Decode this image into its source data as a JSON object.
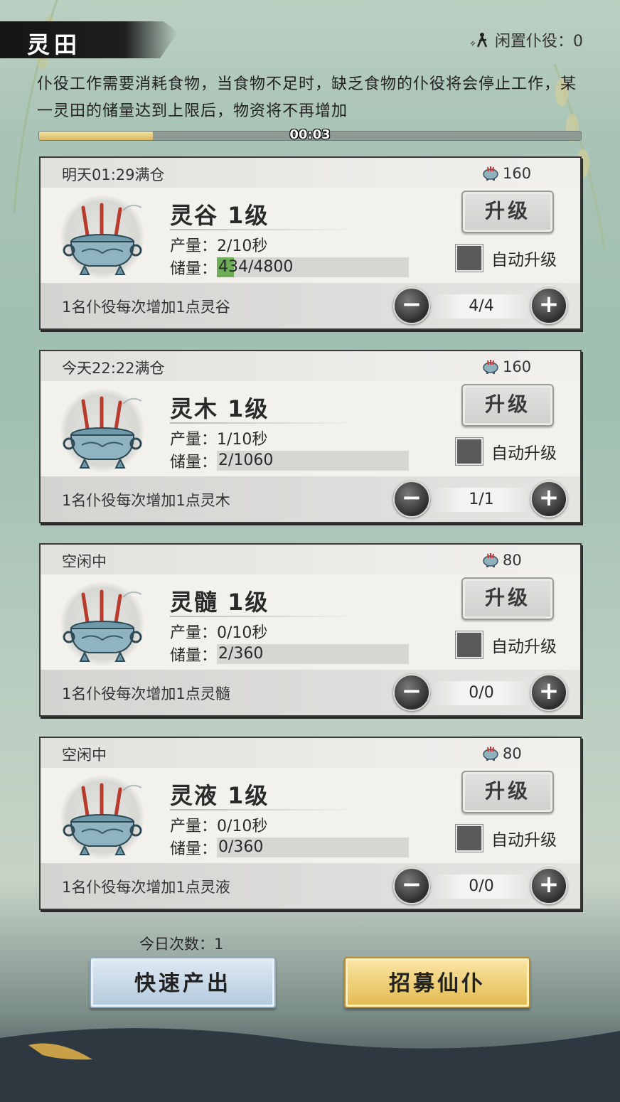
{
  "header": {
    "title": "灵田",
    "idle_label": "闲置仆役：0"
  },
  "notice": "仆役工作需要消耗食物，当食物不足时，缺乏食物的仆役将会停止工作，某一灵田的储量达到上限后，物资将不再增加",
  "timer": {
    "label": "00:03",
    "progress": 0.21
  },
  "fields": [
    {
      "status": "明天01:29满仓",
      "cost": "160",
      "name": "灵谷 1级",
      "production": "产量：2/10秒",
      "storage_label": "储量：",
      "storage": "434/4800",
      "storage_fraction": 0.09,
      "upgrade": "升级",
      "auto": "自动升级",
      "hint": "1名仆役每次增加1点灵谷",
      "workers": "4/4"
    },
    {
      "status": "今天22:22满仓",
      "cost": "160",
      "name": "灵木 1级",
      "production": "产量：1/10秒",
      "storage_label": "储量：",
      "storage": "2/1060",
      "storage_fraction": 0.0,
      "upgrade": "升级",
      "auto": "自动升级",
      "hint": "1名仆役每次增加1点灵木",
      "workers": "1/1"
    },
    {
      "status": "空闲中",
      "cost": "80",
      "name": "灵髓 1级",
      "production": "产量：0/10秒",
      "storage_label": "储量：",
      "storage": "2/360",
      "storage_fraction": 0.0,
      "upgrade": "升级",
      "auto": "自动升级",
      "hint": "1名仆役每次增加1点灵髓",
      "workers": "0/0"
    },
    {
      "status": "空闲中",
      "cost": "80",
      "name": "灵液 1级",
      "production": "产量：0/10秒",
      "storage_label": "储量：",
      "storage": "0/360",
      "storage_fraction": 0.0,
      "upgrade": "升级",
      "auto": "自动升级",
      "hint": "1名仆役每次增加1点灵液",
      "workers": "0/0"
    }
  ],
  "controls": {
    "minus": "−",
    "plus": "+"
  },
  "footer": {
    "today_count": "今日次数：1",
    "quick_button": "快速产出",
    "recruit_button": "招募仙仆"
  },
  "colors": {
    "accent_gold": "#e2b94f",
    "accent_blue": "#b3c9dc",
    "storage_fill": "#6fae58",
    "checkbox": "#5a5a5a"
  }
}
